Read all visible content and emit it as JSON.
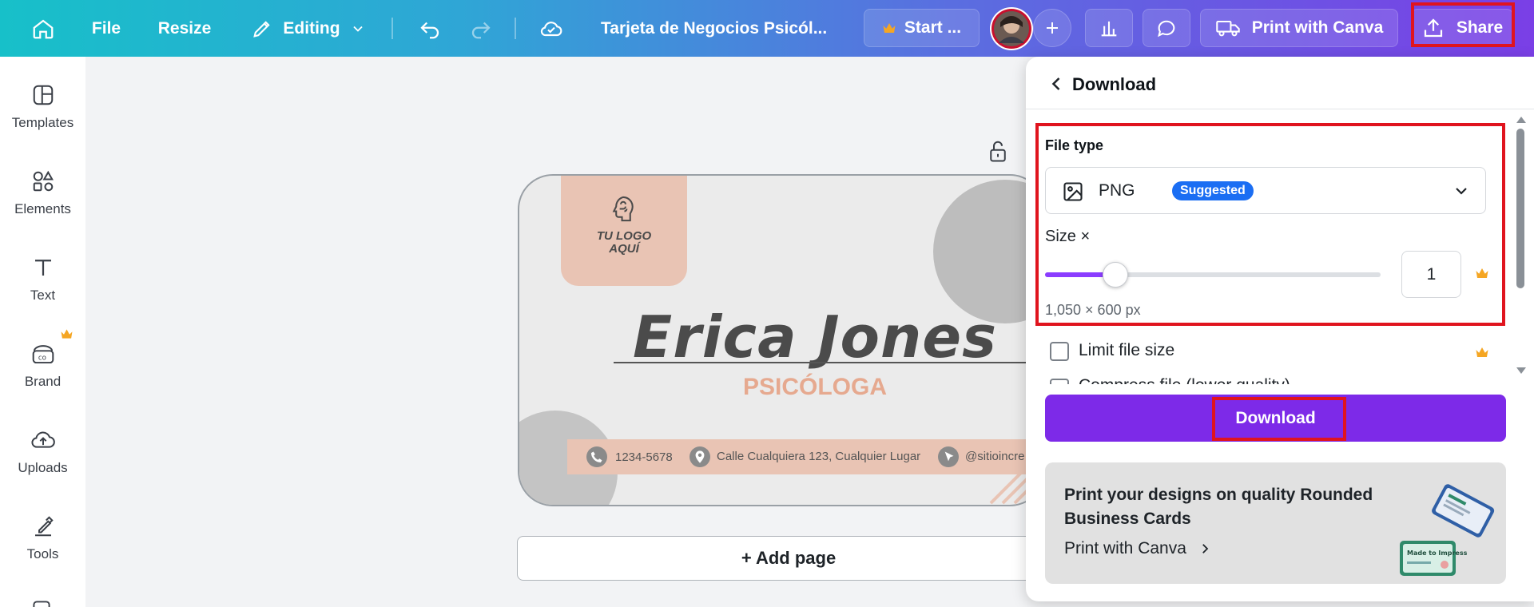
{
  "topbar": {
    "file_label": "File",
    "resize_label": "Resize",
    "editing_label": "Editing",
    "doc_title": "Tarjeta de Negocios Psicól...",
    "start_label": "Start ...",
    "print_label": "Print with Canva",
    "share_label": "Share"
  },
  "sidebar": {
    "items": [
      {
        "label": "Templates",
        "icon": "templates-icon"
      },
      {
        "label": "Elements",
        "icon": "elements-icon"
      },
      {
        "label": "Text",
        "icon": "text-icon"
      },
      {
        "label": "Brand",
        "icon": "brand-icon"
      },
      {
        "label": "Uploads",
        "icon": "uploads-icon"
      },
      {
        "label": "Tools",
        "icon": "tools-icon"
      }
    ]
  },
  "card": {
    "logo_line1": "TU LOGO",
    "logo_line2": "AQUÍ",
    "name": "Erica Jones",
    "role": "PSICÓLOGA",
    "phone": "1234-5678",
    "address": "Calle Cualquiera 123, Cualquier Lugar",
    "web": "@sitioincre"
  },
  "add_page_label": "+ Add page",
  "download_panel": {
    "title": "Download",
    "file_type_label": "File type",
    "file_type_value": "PNG",
    "file_type_badge": "Suggested",
    "size_label": "Size ×",
    "size_value": "1",
    "size_slider_fraction": 0.21,
    "dimensions": "1,050 × 600 px",
    "limit_file_size_label": "Limit file size",
    "compress_label": "Compress file (lower quality)",
    "download_button": "Download",
    "promo_title": "Print your designs on quality Rounded Business Cards",
    "promo_link": "Print with Canva",
    "promo_card_text": "Made to Impress"
  },
  "colors": {
    "accent_purple": "#7d2ae8",
    "badge_blue": "#1b6ef3",
    "highlight_red": "#e0141e",
    "crown_gold": "#f5a623",
    "card_peach": "#e9c4b4"
  }
}
